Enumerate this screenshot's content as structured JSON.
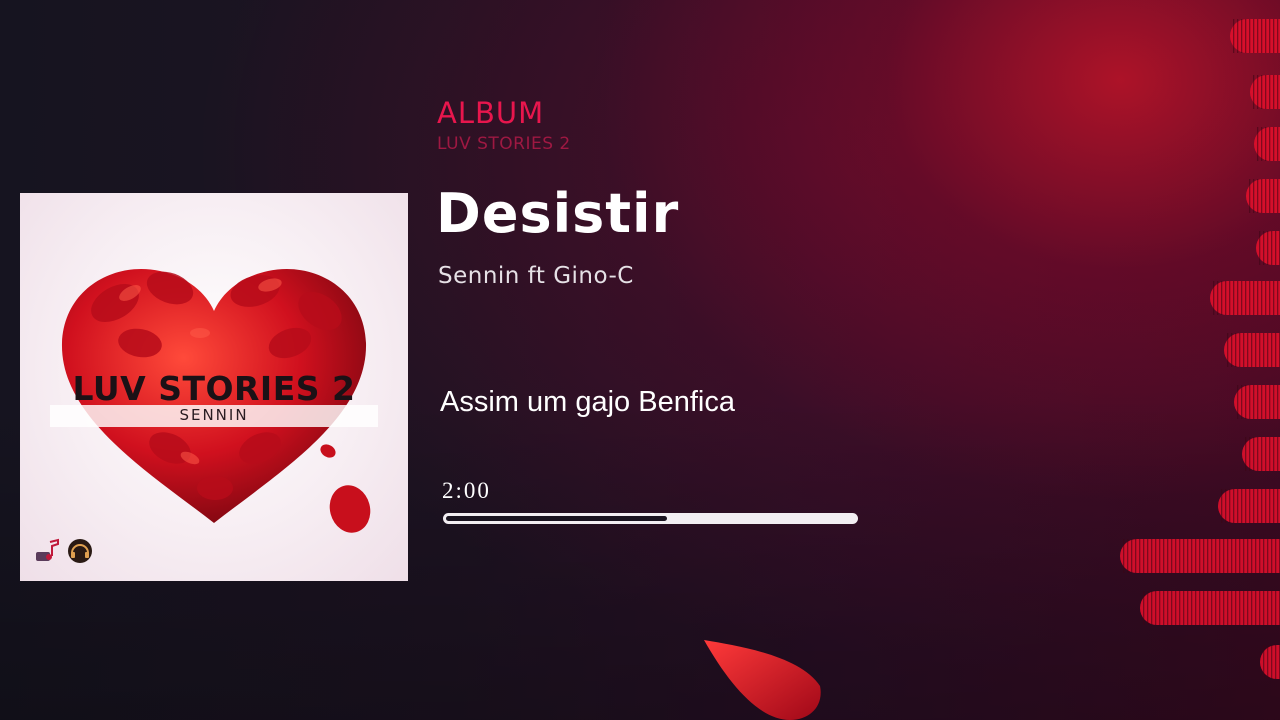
{
  "header": {
    "album_label": "ALBUM",
    "album_name": "LUV STORIES 2"
  },
  "track": {
    "title": "Desistir",
    "artist": "Sennin ft Gino-C",
    "lyric": "Assim um gajo Benfica"
  },
  "player": {
    "time": "2:00",
    "progress_fraction": 0.54
  },
  "cover": {
    "title": "LUV STORIES 2",
    "artist": "SENNIN",
    "logos": [
      "music-note-logo-icon",
      "headphones-logo-icon"
    ]
  },
  "colors": {
    "accent": "#e8164d",
    "album_name": "#9e1842",
    "visualizer": "#e0102c",
    "petal": "#d0101e"
  }
}
